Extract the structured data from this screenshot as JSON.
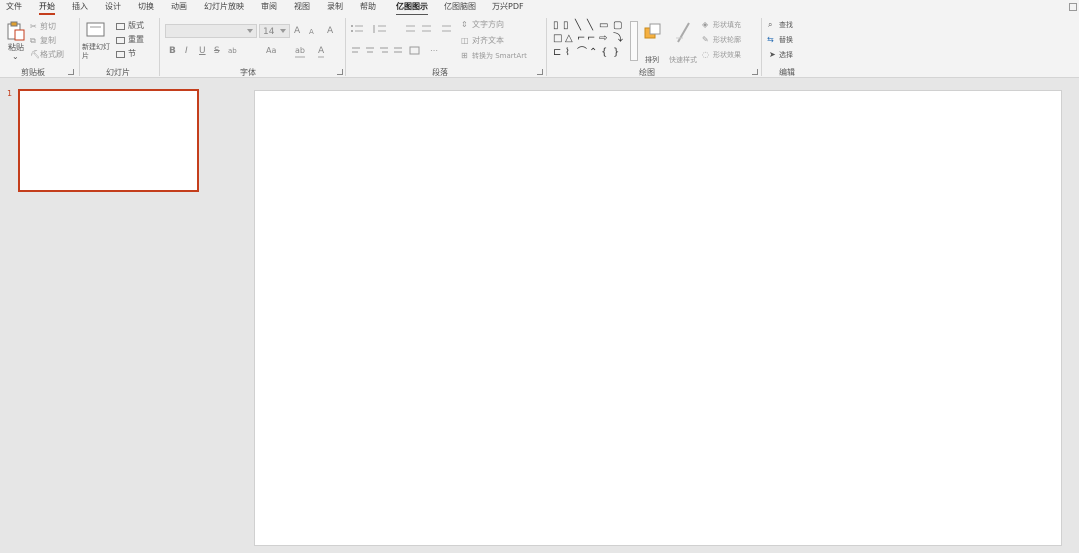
{
  "tabs": [
    {
      "label": "文件"
    },
    {
      "label": "开始"
    },
    {
      "label": "插入"
    },
    {
      "label": "设计"
    },
    {
      "label": "切换"
    },
    {
      "label": "动画"
    },
    {
      "label": "幻灯片放映"
    },
    {
      "label": "审阅"
    },
    {
      "label": "视图"
    },
    {
      "label": "录制"
    },
    {
      "label": "帮助"
    },
    {
      "label": "亿图图示"
    },
    {
      "label": "亿图脑图"
    },
    {
      "label": "万兴PDF"
    }
  ],
  "clipboard": {
    "paste": "粘贴",
    "cut": "剪切",
    "copy": "复制",
    "format_painter": "格式刷",
    "group": "剪贴板"
  },
  "slides": {
    "new_slide": "新建幻灯片",
    "layout": "版式",
    "reset": "重置",
    "section": "节",
    "group": "幻灯片"
  },
  "font": {
    "font_name": "",
    "font_size": "14",
    "bold": "B",
    "italic": "I",
    "underline": "U",
    "strike": "S",
    "spacing": "ab",
    "case": "Aa",
    "grow": "A",
    "shrink": "A",
    "clear": "A",
    "highlight": "ab",
    "color": "A",
    "group": "字体"
  },
  "paragraph": {
    "text_direction": "文字方向",
    "align_text": "对齐文本",
    "smartart": "转换为 SmartArt",
    "group": "段落"
  },
  "drawing": {
    "arrange": "排列",
    "quick_styles": "快速样式",
    "shape_fill": "形状填充",
    "shape_outline": "形状轮廓",
    "shape_effects": "形状效果",
    "group": "绘图"
  },
  "editing": {
    "find": "查找",
    "replace": "替换",
    "select": "选择",
    "group": "编辑"
  },
  "thumbnail": {
    "number": "1"
  },
  "colors": {
    "accent": "#c43e1c",
    "ribbon_bg": "#f3f3f3",
    "workspace_bg": "#e6e6e6"
  }
}
